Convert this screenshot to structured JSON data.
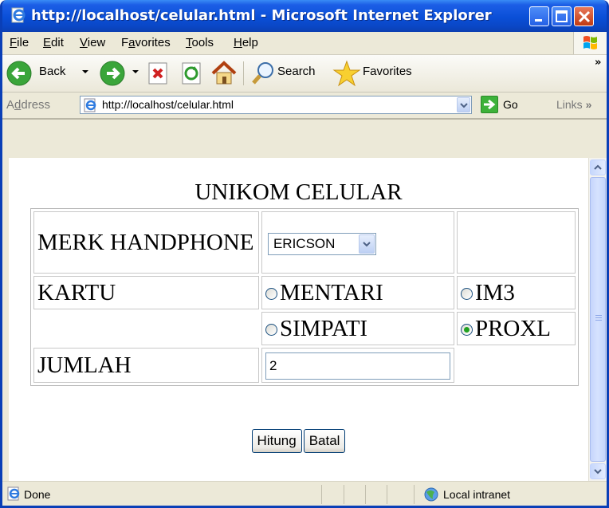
{
  "window": {
    "title": "http://localhost/celular.html - Microsoft Internet Explorer"
  },
  "menu": {
    "items": [
      {
        "mnemonic": "F",
        "rest": "ile"
      },
      {
        "mnemonic": "E",
        "rest": "dit"
      },
      {
        "mnemonic": "V",
        "rest": "iew"
      },
      {
        "pre": "F",
        "mnemonic": "a",
        "rest": "vorites"
      },
      {
        "mnemonic": "T",
        "rest": "ools"
      },
      {
        "mnemonic": "H",
        "rest": "elp"
      }
    ]
  },
  "toolbar": {
    "back_label": "Back",
    "search_label": "Search",
    "favorites_label": "Favorites",
    "overflow": "»"
  },
  "address": {
    "label_pre": "A",
    "label_mnemonic": "d",
    "label_rest": "dress",
    "url": "http://localhost/celular.html",
    "go_label": "Go",
    "links_label": "Links",
    "links_overflow": "»"
  },
  "page": {
    "title": "UNIKOM CELULAR",
    "merk_label": "MERK HANDPHONE",
    "merk_selected": "ERICSON",
    "kartu_label": "KARTU",
    "kartu_options": [
      {
        "label": "MENTARI",
        "checked": false
      },
      {
        "label": "IM3",
        "checked": false
      },
      {
        "label": "SIMPATI",
        "checked": false
      },
      {
        "label": "PROXL",
        "checked": true
      }
    ],
    "jumlah_label": "JUMLAH",
    "jumlah_value": "2",
    "hitung_label": "Hitung",
    "batal_label": "Batal"
  },
  "status": {
    "text": "Done",
    "zone": "Local intranet"
  },
  "icons": {
    "back": "back-arrow-icon",
    "forward": "forward-arrow-icon",
    "stop": "stop-icon",
    "refresh": "refresh-icon",
    "home": "home-icon",
    "search": "magnifier-icon",
    "favorites": "star-icon"
  },
  "colors": {
    "titlebar": "#0a4fd7",
    "go": "#3db23a",
    "radio_checked": "#21a121"
  }
}
